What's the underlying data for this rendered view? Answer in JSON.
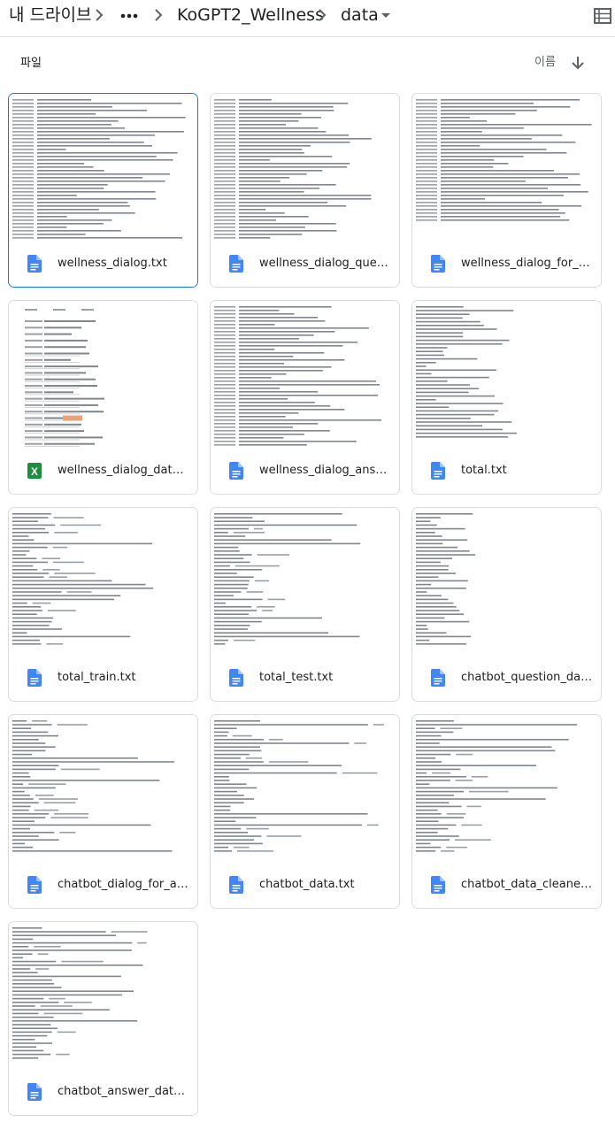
{
  "breadcrumb": {
    "root": "내 드라이브",
    "more_icon": "more-horiz-icon",
    "folder": "KoGPT2_Wellness",
    "current": "data"
  },
  "section": {
    "label": "파일",
    "sort_label": "이름"
  },
  "colors": {
    "selected_border": "#1a73e8",
    "doc_icon": "#4285f4",
    "sheet_icon": "#1e8e3e",
    "highlight": "#e8a37a"
  },
  "files": [
    {
      "name": "wellness_dialog.txt",
      "type": "document",
      "selected": true
    },
    {
      "name": "wellness_dialog_question.txt",
      "type": "document"
    },
    {
      "name": "wellness_dialog_for_autoregressive.txt",
      "type": "document"
    },
    {
      "name": "wellness_dialog_dataset.xlsx",
      "type": "spreadsheet"
    },
    {
      "name": "wellness_dialog_answer.txt",
      "type": "document"
    },
    {
      "name": "total.txt",
      "type": "document"
    },
    {
      "name": "total_train.txt",
      "type": "document"
    },
    {
      "name": "total_test.txt",
      "type": "document"
    },
    {
      "name": "chatbot_question_data.txt",
      "type": "document"
    },
    {
      "name": "chatbot_dialog_for_autoregressive.txt",
      "type": "document"
    },
    {
      "name": "chatbot_data.txt",
      "type": "document"
    },
    {
      "name": "chatbot_data_cleaned.txt",
      "type": "document"
    },
    {
      "name": "chatbot_answer_data.txt",
      "type": "document"
    }
  ]
}
